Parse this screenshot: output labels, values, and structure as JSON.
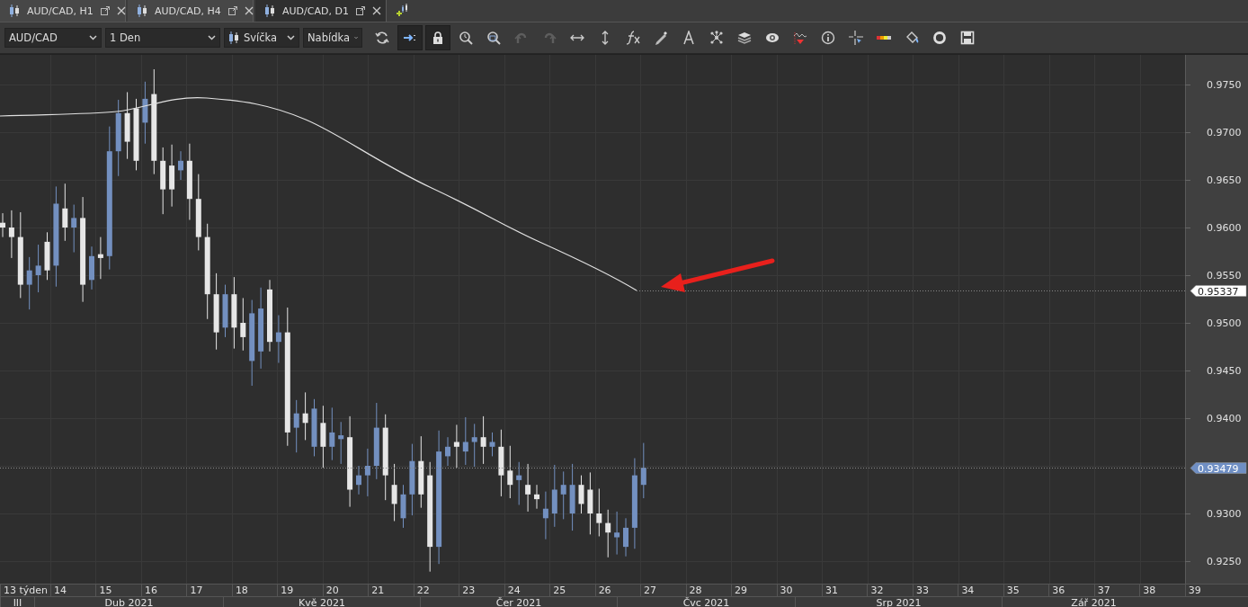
{
  "tabs": [
    {
      "label": "AUD/CAD, H1",
      "selected": false
    },
    {
      "label": "AUD/CAD, H4",
      "selected": false
    },
    {
      "label": "AUD/CAD, D1",
      "selected": true
    }
  ],
  "toolbar": {
    "dropdowns": [
      {
        "value": "AUD/CAD",
        "kind": "plain"
      },
      {
        "value": "1 Den",
        "kind": "plain"
      },
      {
        "value": "Svíčka",
        "kind": "chart_type"
      },
      {
        "value": "Nabídka",
        "kind": "plain"
      }
    ],
    "buttons": [
      {
        "kind": "refresh",
        "pressed": false,
        "disabled": false
      },
      {
        "kind": "scroll_end",
        "pressed": true,
        "disabled": false
      },
      {
        "kind": "lock",
        "pressed": true,
        "disabled": false
      },
      {
        "kind": "zoom_in",
        "pressed": false,
        "disabled": false
      },
      {
        "kind": "zoom_out",
        "pressed": false,
        "disabled": false
      },
      {
        "kind": "undo",
        "pressed": false,
        "disabled": true
      },
      {
        "kind": "redo",
        "pressed": false,
        "disabled": true
      },
      {
        "kind": "hscale",
        "pressed": false,
        "disabled": false
      },
      {
        "kind": "vscale",
        "pressed": false,
        "disabled": false
      },
      {
        "kind": "fx",
        "pressed": false,
        "disabled": false
      },
      {
        "kind": "pencil",
        "pressed": false,
        "disabled": false
      },
      {
        "kind": "text",
        "pressed": false,
        "disabled": false
      },
      {
        "kind": "objects",
        "pressed": false,
        "disabled": false
      },
      {
        "kind": "layers",
        "pressed": false,
        "disabled": false
      },
      {
        "kind": "eye",
        "pressed": false,
        "disabled": false
      },
      {
        "kind": "indicator",
        "pressed": false,
        "disabled": false
      },
      {
        "kind": "info",
        "pressed": false,
        "disabled": false
      },
      {
        "kind": "crosshair",
        "pressed": false,
        "disabled": false
      },
      {
        "kind": "colors",
        "pressed": false,
        "disabled": false
      },
      {
        "kind": "fill",
        "pressed": false,
        "disabled": false
      },
      {
        "kind": "circle",
        "pressed": false,
        "disabled": false
      },
      {
        "kind": "save",
        "pressed": false,
        "disabled": false
      }
    ]
  },
  "chart": {
    "price_ticks": [
      "0.9750",
      "0.9700",
      "0.9650",
      "0.9600",
      "0.9550",
      "0.9500",
      "0.9450",
      "0.9400",
      "0.9300",
      "0.9250"
    ],
    "price_labels": [
      {
        "text": "0.95337",
        "kind": "line"
      },
      {
        "text": "0.93479",
        "kind": "bid"
      }
    ],
    "weeks": [
      "13 týden",
      "14",
      "15",
      "16",
      "17",
      "18",
      "19",
      "20",
      "21",
      "22",
      "23",
      "24",
      "25",
      "26",
      "27",
      "28",
      "29",
      "30",
      "31",
      "32",
      "33",
      "34",
      "35",
      "36",
      "37",
      "38",
      "39"
    ],
    "months": [
      "III",
      "Dub 2021",
      "Kvě 2021",
      "Čer 2021",
      "Čvc 2021",
      "Srp 2021",
      "Zář 2021"
    ]
  }
}
